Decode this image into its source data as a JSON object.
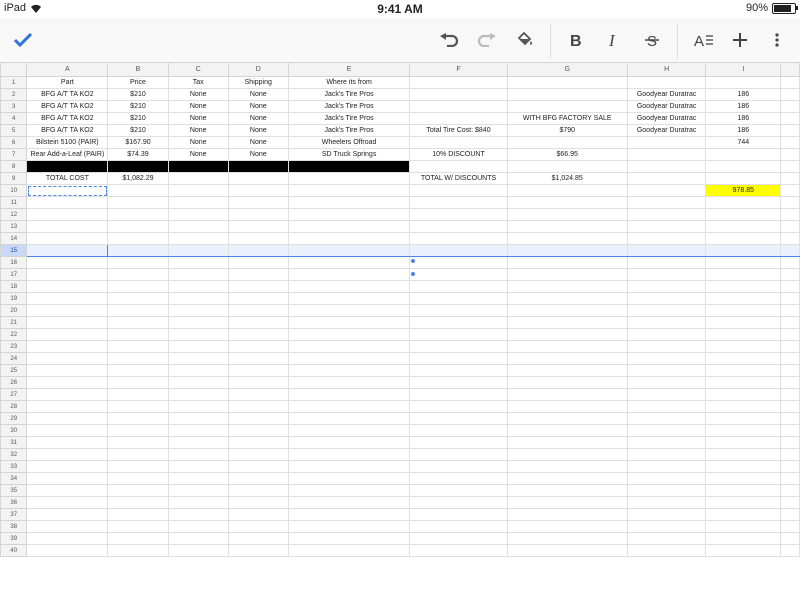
{
  "status": {
    "device": "iPad",
    "time": "9:41 AM",
    "battery": "90%"
  },
  "toolbar": {
    "icons": [
      "check-icon",
      "undo-icon",
      "redo-icon",
      "fill-color-icon",
      "bold-icon",
      "italic-icon",
      "strikethrough-icon",
      "text-format-icon",
      "add-icon",
      "more-icon"
    ]
  },
  "colors": {
    "accent": "#4a86e8",
    "highlight": "#ffff00"
  },
  "columns": [
    "A",
    "B",
    "C",
    "D",
    "E",
    "F",
    "G",
    "H",
    "I"
  ],
  "rows": [
    {
      "n": "1",
      "c": [
        "Part",
        "Price",
        "Tax",
        "Shipping",
        "Where its from",
        "",
        "",
        "",
        ""
      ]
    },
    {
      "n": "2",
      "c": [
        "BFG A/T TA KO2",
        "$210",
        "None",
        "None",
        "Jack's Tire Pros",
        "",
        "",
        "Goodyear Duratrac",
        "186"
      ]
    },
    {
      "n": "3",
      "c": [
        "BFG A/T TA KO2",
        "$210",
        "None",
        "None",
        "Jack's Tire Pros",
        "",
        "",
        "Goodyear Duratrac",
        "186"
      ]
    },
    {
      "n": "4",
      "c": [
        "BFG A/T TA KO2",
        "$210",
        "None",
        "None",
        "Jack's Tire Pros",
        "",
        "WITH BFG FACTORY SALE",
        "Goodyear Duratrac",
        "186"
      ]
    },
    {
      "n": "5",
      "c": [
        "BFG A/T TA KO2",
        "$210",
        "None",
        "None",
        "Jack's Tire Pros",
        "Total Tire Cost: $840",
        "$790",
        "Goodyear Duratrac",
        "186"
      ]
    },
    {
      "n": "6",
      "c": [
        "Bilstein 5100 (PAIR)",
        "$167.90",
        "None",
        "None",
        "Wheelers Offroad",
        "",
        "",
        "",
        "744"
      ]
    },
    {
      "n": "7",
      "c": [
        "Rear Add-a-Leaf (PAIR)",
        "$74.39",
        "None",
        "None",
        "SD Truck Springs",
        "10% DISCOUNT",
        "$66.95",
        "",
        ""
      ]
    },
    {
      "n": "8",
      "c": [
        "",
        "",
        "",
        "",
        "",
        "",
        "",
        "",
        ""
      ]
    },
    {
      "n": "9",
      "c": [
        "TOTAL COST",
        "$1,082.29",
        "",
        "",
        "",
        "TOTAL W/ DISCOUNTS",
        "$1,024.85",
        "",
        ""
      ]
    },
    {
      "n": "10",
      "c": [
        "",
        "",
        "",
        "",
        "",
        "",
        "",
        "",
        "978.85"
      ]
    },
    {
      "n": "11",
      "c": [
        "",
        "",
        "",
        "",
        "",
        "",
        "",
        "",
        ""
      ]
    },
    {
      "n": "12",
      "c": [
        "",
        "",
        "",
        "",
        "",
        "",
        "",
        "",
        ""
      ]
    },
    {
      "n": "13",
      "c": [
        "",
        "",
        "",
        "",
        "",
        "",
        "",
        "",
        ""
      ]
    },
    {
      "n": "14",
      "c": [
        "",
        "",
        "",
        "",
        "",
        "",
        "",
        "",
        ""
      ]
    },
    {
      "n": "15",
      "c": [
        "",
        "",
        "",
        "",
        "",
        "",
        "",
        "",
        ""
      ]
    },
    {
      "n": "16",
      "c": [
        "",
        "",
        "",
        "",
        "",
        "",
        "",
        "",
        ""
      ]
    },
    {
      "n": "17",
      "c": [
        "",
        "",
        "",
        "",
        "",
        "",
        "",
        "",
        ""
      ]
    },
    {
      "n": "18",
      "c": [
        "",
        "",
        "",
        "",
        "",
        "",
        "",
        "",
        ""
      ]
    },
    {
      "n": "19",
      "c": [
        "",
        "",
        "",
        "",
        "",
        "",
        "",
        "",
        ""
      ]
    },
    {
      "n": "20",
      "c": [
        "",
        "",
        "",
        "",
        "",
        "",
        "",
        "",
        ""
      ]
    },
    {
      "n": "21",
      "c": [
        "",
        "",
        "",
        "",
        "",
        "",
        "",
        "",
        ""
      ]
    },
    {
      "n": "22",
      "c": [
        "",
        "",
        "",
        "",
        "",
        "",
        "",
        "",
        ""
      ]
    },
    {
      "n": "23",
      "c": [
        "",
        "",
        "",
        "",
        "",
        "",
        "",
        "",
        ""
      ]
    },
    {
      "n": "24",
      "c": [
        "",
        "",
        "",
        "",
        "",
        "",
        "",
        "",
        ""
      ]
    },
    {
      "n": "25",
      "c": [
        "",
        "",
        "",
        "",
        "",
        "",
        "",
        "",
        ""
      ]
    },
    {
      "n": "26",
      "c": [
        "",
        "",
        "",
        "",
        "",
        "",
        "",
        "",
        ""
      ]
    },
    {
      "n": "27",
      "c": [
        "",
        "",
        "",
        "",
        "",
        "",
        "",
        "",
        ""
      ]
    },
    {
      "n": "28",
      "c": [
        "",
        "",
        "",
        "",
        "",
        "",
        "",
        "",
        ""
      ]
    },
    {
      "n": "29",
      "c": [
        "",
        "",
        "",
        "",
        "",
        "",
        "",
        "",
        ""
      ]
    },
    {
      "n": "30",
      "c": [
        "",
        "",
        "",
        "",
        "",
        "",
        "",
        "",
        ""
      ]
    },
    {
      "n": "31",
      "c": [
        "",
        "",
        "",
        "",
        "",
        "",
        "",
        "",
        ""
      ]
    },
    {
      "n": "32",
      "c": [
        "",
        "",
        "",
        "",
        "",
        "",
        "",
        "",
        ""
      ]
    },
    {
      "n": "33",
      "c": [
        "",
        "",
        "",
        "",
        "",
        "",
        "",
        "",
        ""
      ]
    },
    {
      "n": "34",
      "c": [
        "",
        "",
        "",
        "",
        "",
        "",
        "",
        "",
        ""
      ]
    },
    {
      "n": "35",
      "c": [
        "",
        "",
        "",
        "",
        "",
        "",
        "",
        "",
        ""
      ]
    },
    {
      "n": "36",
      "c": [
        "",
        "",
        "",
        "",
        "",
        "",
        "",
        "",
        ""
      ]
    },
    {
      "n": "37",
      "c": [
        "",
        "",
        "",
        "",
        "",
        "",
        "",
        "",
        ""
      ]
    },
    {
      "n": "38",
      "c": [
        "",
        "",
        "",
        "",
        "",
        "",
        "",
        "",
        ""
      ]
    },
    {
      "n": "39",
      "c": [
        "",
        "",
        "",
        "",
        "",
        "",
        "",
        "",
        ""
      ]
    },
    {
      "n": "40",
      "c": [
        "",
        "",
        "",
        "",
        "",
        "",
        "",
        "",
        ""
      ]
    }
  ]
}
